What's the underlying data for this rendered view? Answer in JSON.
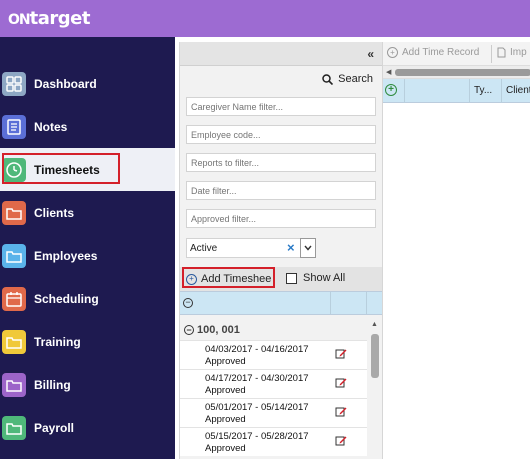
{
  "app": {
    "logo_prefix": "ON",
    "logo_main": "target"
  },
  "sidebar": {
    "items": [
      {
        "label": "Dashboard",
        "icon": "dashboard-icon",
        "color": "#8da7c4"
      },
      {
        "label": "Notes",
        "icon": "notes-icon",
        "color": "#5b6fd6"
      },
      {
        "label": "Timesheets",
        "icon": "clock-icon",
        "color": "#4fb87a",
        "active": true
      },
      {
        "label": "Clients",
        "icon": "folder-icon",
        "color": "#e0694a"
      },
      {
        "label": "Employees",
        "icon": "folder-icon",
        "color": "#5ab3ea"
      },
      {
        "label": "Scheduling",
        "icon": "calendar-icon",
        "color": "#e0694a"
      },
      {
        "label": "Training",
        "icon": "folder-icon",
        "color": "#f0c93a"
      },
      {
        "label": "Billing",
        "icon": "folder-icon",
        "color": "#9c64c9"
      },
      {
        "label": "Payroll",
        "icon": "folder-icon",
        "color": "#4fb87a"
      }
    ]
  },
  "panel": {
    "collapse_label": "«",
    "search_label": "Search",
    "filters": {
      "caregiver": "Caregiver Name filter...",
      "employee": "Employee code...",
      "reports": "Reports to filter...",
      "date": "Date filter...",
      "approved": "Approved filter..."
    },
    "status_value": "Active",
    "add_timesheet_label": "Add Timeshee",
    "show_all_label": "Show All",
    "group_label": "100, 001",
    "rows": [
      {
        "dates": "04/03/2017 - 04/16/2017",
        "status": "Approved"
      },
      {
        "dates": "04/17/2017 - 04/30/2017",
        "status": "Approved"
      },
      {
        "dates": "05/01/2017 - 05/14/2017",
        "status": "Approved"
      },
      {
        "dates": "05/15/2017 - 05/28/2017",
        "status": "Approved"
      }
    ]
  },
  "right": {
    "add_time_record_label": "Add Time Record",
    "import_label": "Imp",
    "col_type": "Ty...",
    "col_client": "Client"
  }
}
